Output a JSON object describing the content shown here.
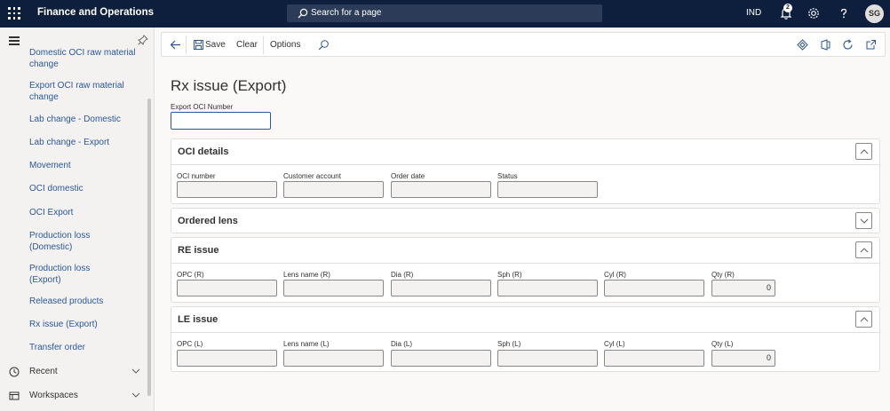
{
  "app": {
    "title": "Finance and Operations",
    "search_placeholder": "Search for a page",
    "company": "IND",
    "notification_count": "2",
    "user_initials": "SG"
  },
  "sidebar": {
    "items": [
      "Domestic OCI raw material change",
      "Export OCI raw material change",
      "Lab change - Domestic",
      "Lab change - Export",
      "Movement",
      "OCI domestic",
      "OCI Export",
      "Production loss (Domestic)",
      "Production loss (Export)",
      "Released products",
      "Rx issue (Export)",
      "Transfer order"
    ],
    "groups": {
      "recent": "Recent",
      "workspaces": "Workspaces"
    }
  },
  "actionpane": {
    "save": "Save",
    "clear": "Clear",
    "options": "Options"
  },
  "page": {
    "title": "Rx issue (Export)",
    "export_oci_label": "Export OCI Number",
    "export_oci_value": ""
  },
  "oci_details": {
    "title": "OCI details",
    "fields": [
      "OCI number",
      "Customer account",
      "Order date",
      "Status"
    ]
  },
  "ordered_lens": {
    "title": "Ordered lens"
  },
  "re_issue": {
    "title": "RE issue",
    "fields": [
      "OPC (R)",
      "Lens name (R)",
      "Dia (R)",
      "Sph (R)",
      "Cyl (R)",
      "Qty (R)"
    ],
    "qty_value": "0"
  },
  "le_issue": {
    "title": "LE issue",
    "fields": [
      "OPC (L)",
      "Lens name (L)",
      "Dia (L)",
      "Sph (L)",
      "Cyl (L)",
      "Qty (L)"
    ],
    "qty_value": "0"
  }
}
